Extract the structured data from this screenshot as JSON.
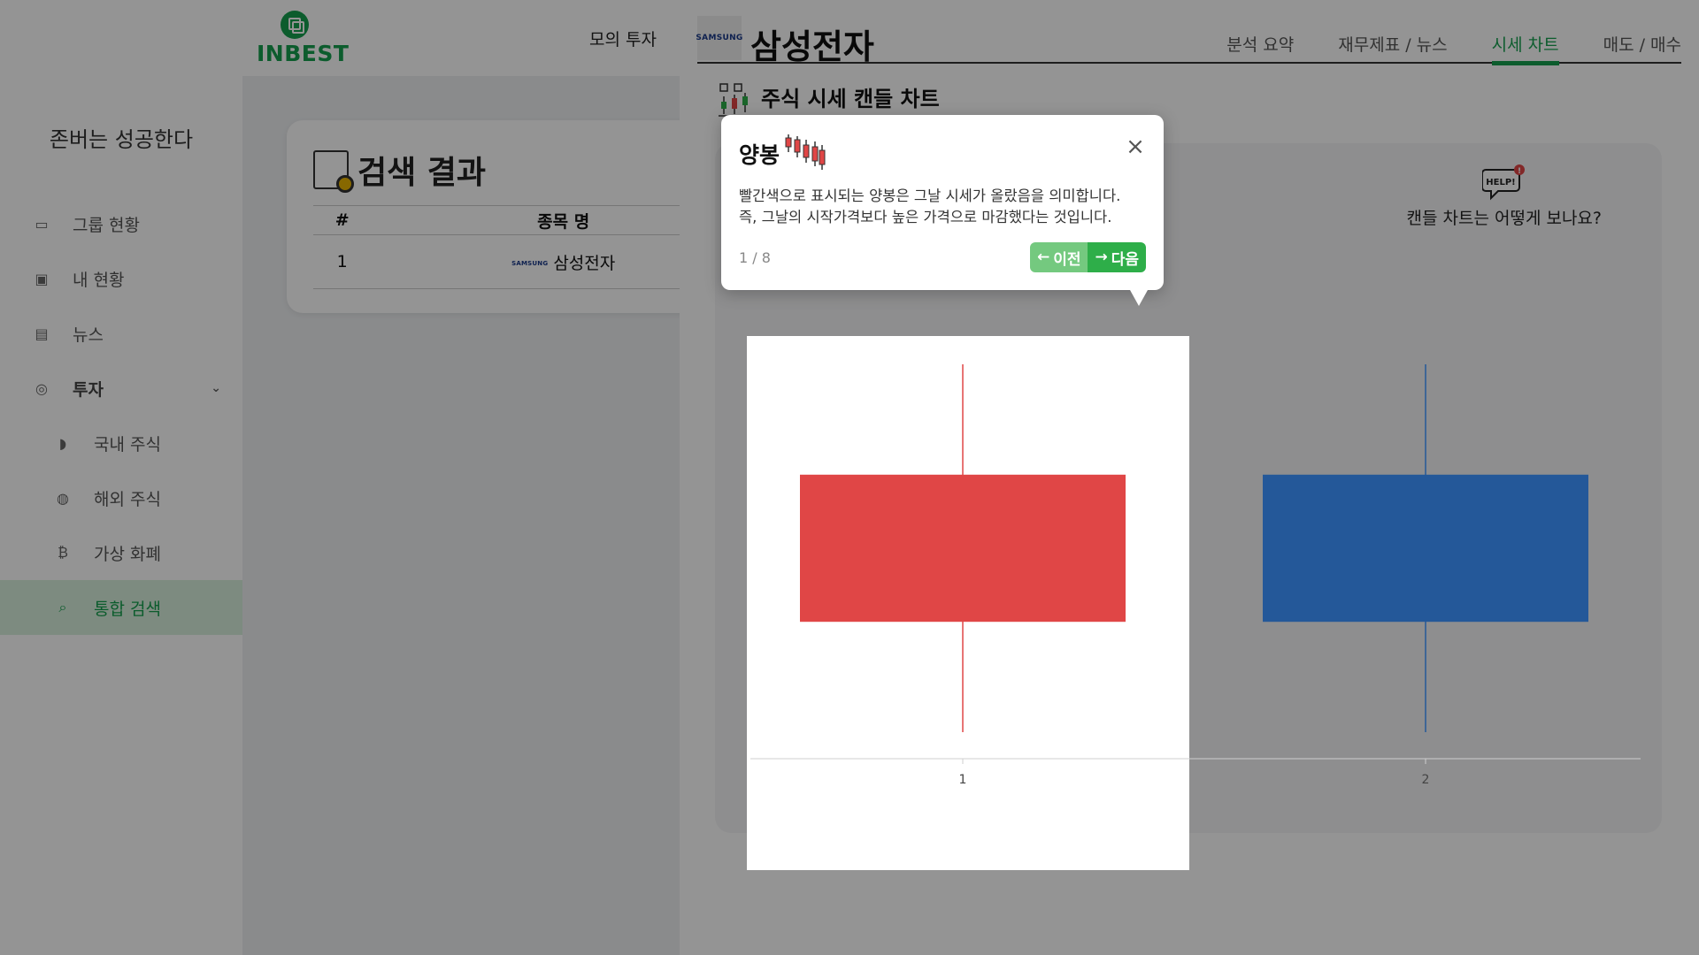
{
  "app": {
    "logo_text": "INBEST",
    "top_nav_item": "모의 투자",
    "slogan": "존버는 성공한다"
  },
  "sidebar": {
    "items": [
      {
        "label": "그룹 현황",
        "icon": "group-board-icon"
      },
      {
        "label": "내 현황",
        "icon": "profile-card-icon"
      },
      {
        "label": "뉴스",
        "icon": "newspaper-icon"
      },
      {
        "label": "투자",
        "icon": "coins-icon",
        "expanded": true
      },
      {
        "label": "국내 주식",
        "icon": "korea-map-icon"
      },
      {
        "label": "해외 주식",
        "icon": "globe-icon"
      },
      {
        "label": "가상 화폐",
        "icon": "bitcoin-icon"
      },
      {
        "label": "통합 검색",
        "icon": "search-document-icon",
        "active": true
      }
    ]
  },
  "search_results": {
    "title": "검색 결과",
    "columns": [
      "#",
      "종목 명"
    ],
    "rows": [
      {
        "index": "1",
        "brand": "SAMSUNG",
        "name": "삼성전자"
      }
    ]
  },
  "drawer": {
    "logo_text": "SAMSUNG",
    "stock_name": "삼성전자",
    "tabs": [
      "분석 요약",
      "재무제표 / 뉴스",
      "시세 차트",
      "매도 / 매수"
    ],
    "active_tab": "시세 차트",
    "chart_title": "주식 시세 캔들 차트",
    "help_text": "캔들 차트는 어떻게 보나요?",
    "help_icon_label": "HELP!"
  },
  "tooltip": {
    "title": "양봉",
    "body_line1": "빨간색으로 표시되는 양봉은 그날 시세가 올랐음을 의미합니다.",
    "body_line2": "즉, 그날의 시작가격보다 높은 가격으로 마감했다는 것입니다.",
    "progress": "1 / 8",
    "prev_label": "이전",
    "next_label": "다음"
  },
  "colors": {
    "brand_green": "#169f4e",
    "bullish_red": "#e04646",
    "bearish_blue": "#245899"
  },
  "chart_data": {
    "type": "candlestick",
    "categories": [
      "1",
      "2"
    ],
    "candles": [
      {
        "x": "1",
        "open": 30,
        "close": 70,
        "low": 0,
        "high": 100,
        "color": "#e04646"
      },
      {
        "x": "2",
        "open": 70,
        "close": 30,
        "low": 0,
        "high": 100,
        "color": "#245899"
      }
    ],
    "ylim": [
      0,
      100
    ],
    "grid": false
  }
}
